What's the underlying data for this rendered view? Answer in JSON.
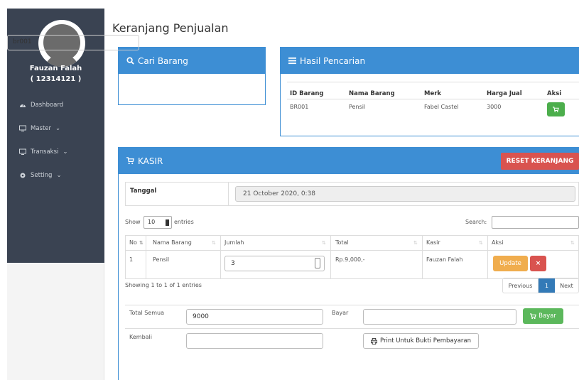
{
  "sidebar": {
    "user_name": "Fauzan Falah",
    "user_id": "( 12314121 )",
    "items": [
      {
        "label": "Dashboard",
        "icon": "dashboard-icon"
      },
      {
        "label": "Master",
        "icon": "desktop-icon"
      },
      {
        "label": "Transaksi",
        "icon": "desktop-icon"
      },
      {
        "label": "Setting",
        "icon": "gear-icon"
      }
    ]
  },
  "page_title": "Keranjang Penjualan",
  "cari": {
    "title": "Cari Barang",
    "value": "br001"
  },
  "hasil": {
    "title": "Hasil Pencarian",
    "headers": [
      "ID Barang",
      "Nama Barang",
      "Merk",
      "Harga Jual",
      "Aksi"
    ],
    "row": [
      "BR001",
      "Pensil",
      "Fabel Castel",
      "3000"
    ]
  },
  "kasir": {
    "title": "KASIR",
    "reset_label": "RESET KERANJANG",
    "tanggal_label": "Tanggal",
    "tanggal_value": "21 October 2020, 0:38",
    "show_label": "Show",
    "entries_value": "10",
    "entries_label": "entries",
    "search_label": "Search:",
    "headers": [
      "No",
      "Nama Barang",
      "Jumlah",
      "Total",
      "Kasir",
      "Aksi"
    ],
    "row": {
      "no": "1",
      "nama": "Pensil",
      "jumlah": "3",
      "total": "Rp.9,000,-",
      "kasir": "Fauzan Falah"
    },
    "update_label": "Update",
    "delete_label": "×",
    "info": "Showing 1 to 1 of 1 entries",
    "pager": {
      "prev": "Previous",
      "page": "1",
      "next": "Next"
    },
    "total_semua_label": "Total Semua",
    "total_semua_value": "9000",
    "bayar_label": "Bayar",
    "bayar_value": "",
    "bayar_button": "Bayar",
    "kembali_label": "Kembali",
    "kembali_value": "",
    "print_label": "Print Untuk Bukti Pembayaran"
  },
  "colors": {
    "primary": "#3d8ed4",
    "sidebar": "#3a4352",
    "danger": "#d9534f",
    "success": "#5cb85c",
    "warning": "#f0ad4e"
  }
}
